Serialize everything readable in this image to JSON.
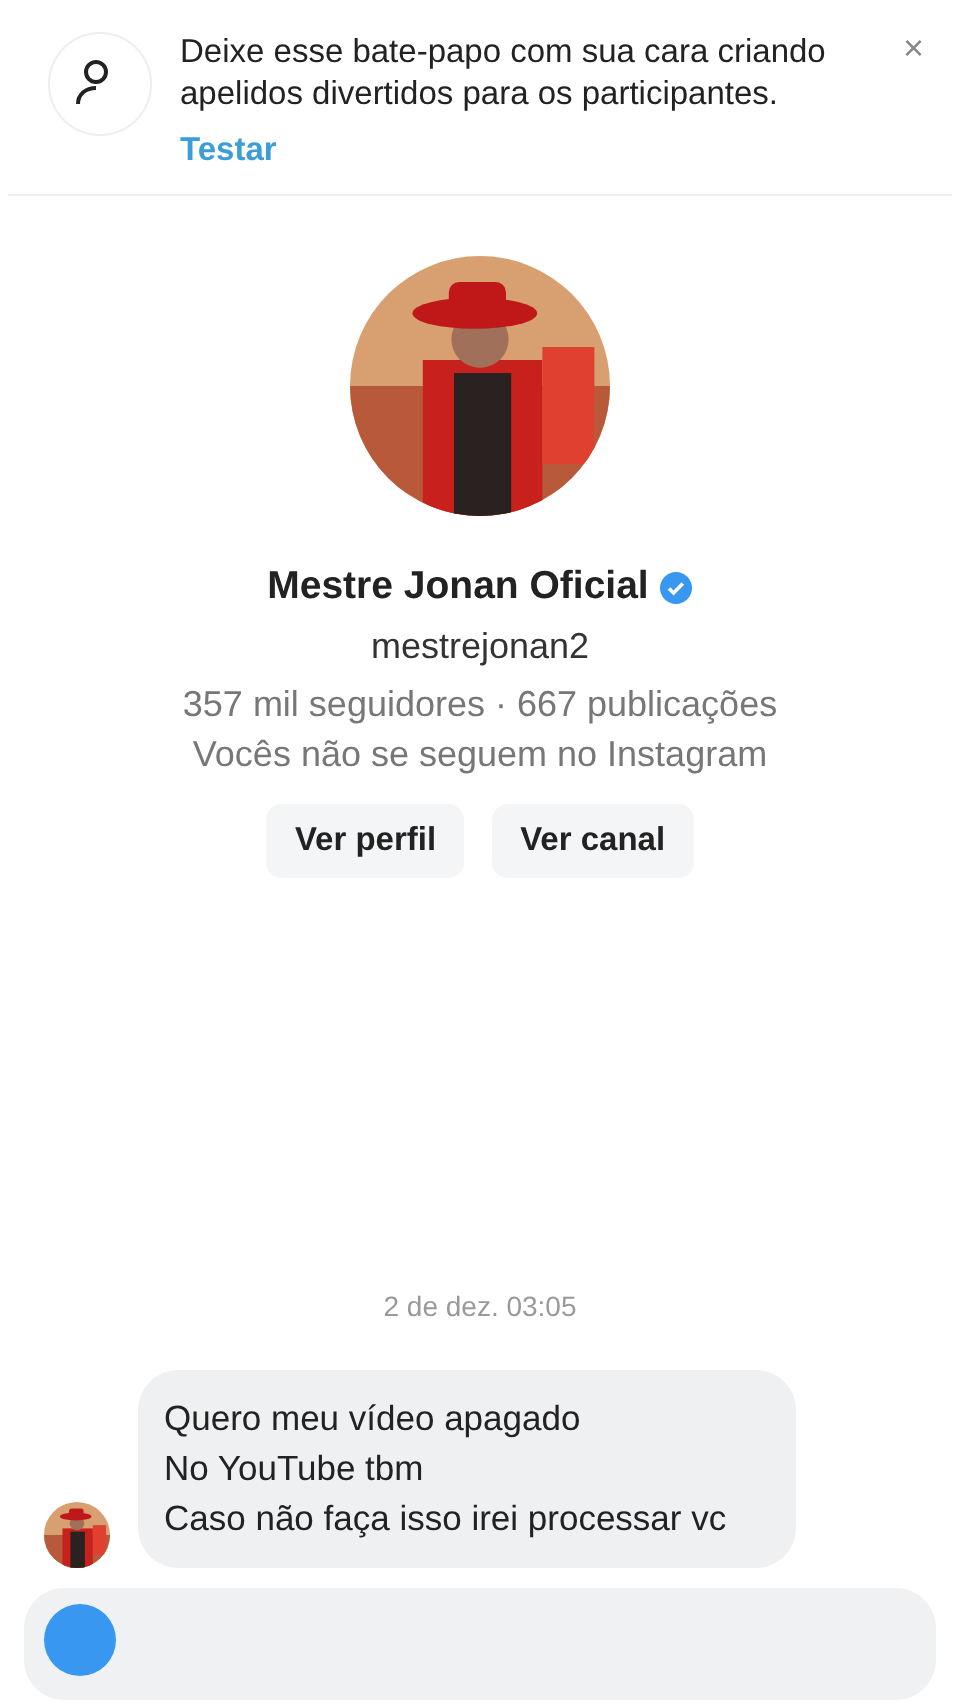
{
  "notice": {
    "text": "Deixe esse bate-papo com sua cara criando apelidos divertidos para os participantes.",
    "action": "Testar",
    "close": "×"
  },
  "profile": {
    "name": "Mestre Jonan Oficial",
    "verified": true,
    "username": "mestrejonan2",
    "stats": "357 mil seguidores · 667 publicações",
    "follow_status": "Vocês não se seguem no Instagram",
    "buttons": [
      "Ver perfil",
      "Ver canal"
    ]
  },
  "timestamp": "2 de dez. 03:05",
  "messages": [
    {
      "lines": [
        "Quero meu vídeo apagado",
        "No YouTube tbm",
        "Caso não faça isso irei processar vc"
      ]
    }
  ]
}
